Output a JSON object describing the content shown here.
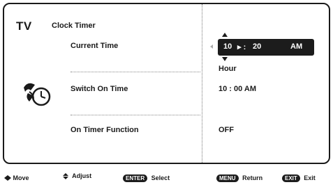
{
  "header": {
    "source": "TV",
    "title": "Clock Timer"
  },
  "settings": [
    {
      "label": "Current Time",
      "value": "10 ▸ :  20     AM",
      "unit": "Hour"
    },
    {
      "label": "Switch On Time",
      "value": "10 : 00  AM"
    },
    {
      "label": "On Timer Function",
      "value": "OFF"
    }
  ],
  "current_time_editor": {
    "hour": "10",
    "minute": "20",
    "ampm": "AM",
    "unit": "Hour"
  },
  "icons": {
    "clock": "clock-timer-icon"
  },
  "footer": {
    "move": "Move",
    "adjust": "Adjust",
    "enter_key": "ENTER",
    "select": "Select",
    "menu_key": "MENU",
    "return": "Return",
    "exit_key": "EXIT",
    "exit": "Exit"
  }
}
